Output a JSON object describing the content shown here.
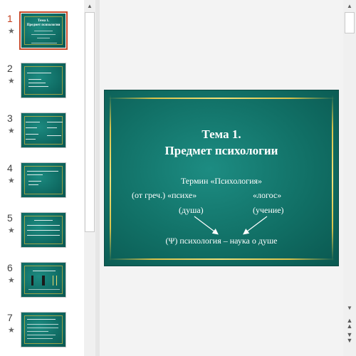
{
  "thumbnails": [
    {
      "number": "1",
      "star": "★",
      "active": true
    },
    {
      "number": "2",
      "star": "★",
      "active": false
    },
    {
      "number": "3",
      "star": "★",
      "active": false
    },
    {
      "number": "4",
      "star": "★",
      "active": false
    },
    {
      "number": "5",
      "star": "★",
      "active": false
    },
    {
      "number": "6",
      "star": "★",
      "active": false
    },
    {
      "number": "7",
      "star": "★",
      "active": false
    }
  ],
  "slide": {
    "title_line1": "Тема 1.",
    "title_line2": "Предмет психологии",
    "term": "Термин «Психология»",
    "greek_prefix": "(от греч.) «психе»",
    "logos": "«логос»",
    "psyche_meaning": "(душа)",
    "logos_meaning": "(учение)",
    "conclusion": "(Ψ) психология – наука о душе"
  },
  "thumb1": {
    "title": "Тема 1.",
    "subtitle": "Предмет психологии"
  },
  "colors": {
    "slide_bg": "#117066",
    "gold_frame": "#e0ca55",
    "active_border": "#c84a2b"
  },
  "icons": {
    "scroll_up": "up-arrow-icon",
    "scroll_down": "down-arrow-icon",
    "prev_slide": "double-up-arrow-icon",
    "next_slide": "double-down-arrow-icon"
  }
}
